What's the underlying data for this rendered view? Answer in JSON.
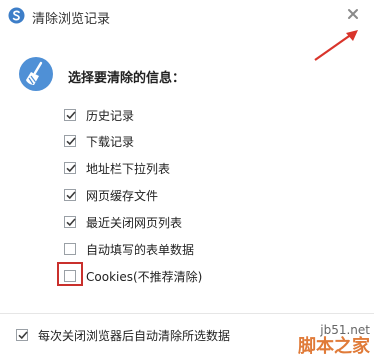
{
  "window": {
    "title": "清除浏览记录",
    "close_icon": "close-icon"
  },
  "header": {
    "icon": "broom-icon",
    "label": "选择要清除的信息："
  },
  "options": [
    {
      "label": "历史记录",
      "checked": true
    },
    {
      "label": "下载记录",
      "checked": true
    },
    {
      "label": "地址栏下拉列表",
      "checked": true
    },
    {
      "label": "网页缓存文件",
      "checked": true
    },
    {
      "label": "最近关闭网页列表",
      "checked": true
    },
    {
      "label": "自动填写的表单数据",
      "checked": false
    },
    {
      "label": "Cookies(不推荐清除)",
      "checked": false
    }
  ],
  "footer": {
    "label": "每次关闭浏览器后自动清除所选数据",
    "checked": true
  },
  "watermark": {
    "url": "jb51.net",
    "text": "脚本之家"
  },
  "colors": {
    "accent": "#4a90d9",
    "highlight": "#c9302c",
    "arrow": "#d9342b",
    "watermark": "#e07b39"
  }
}
